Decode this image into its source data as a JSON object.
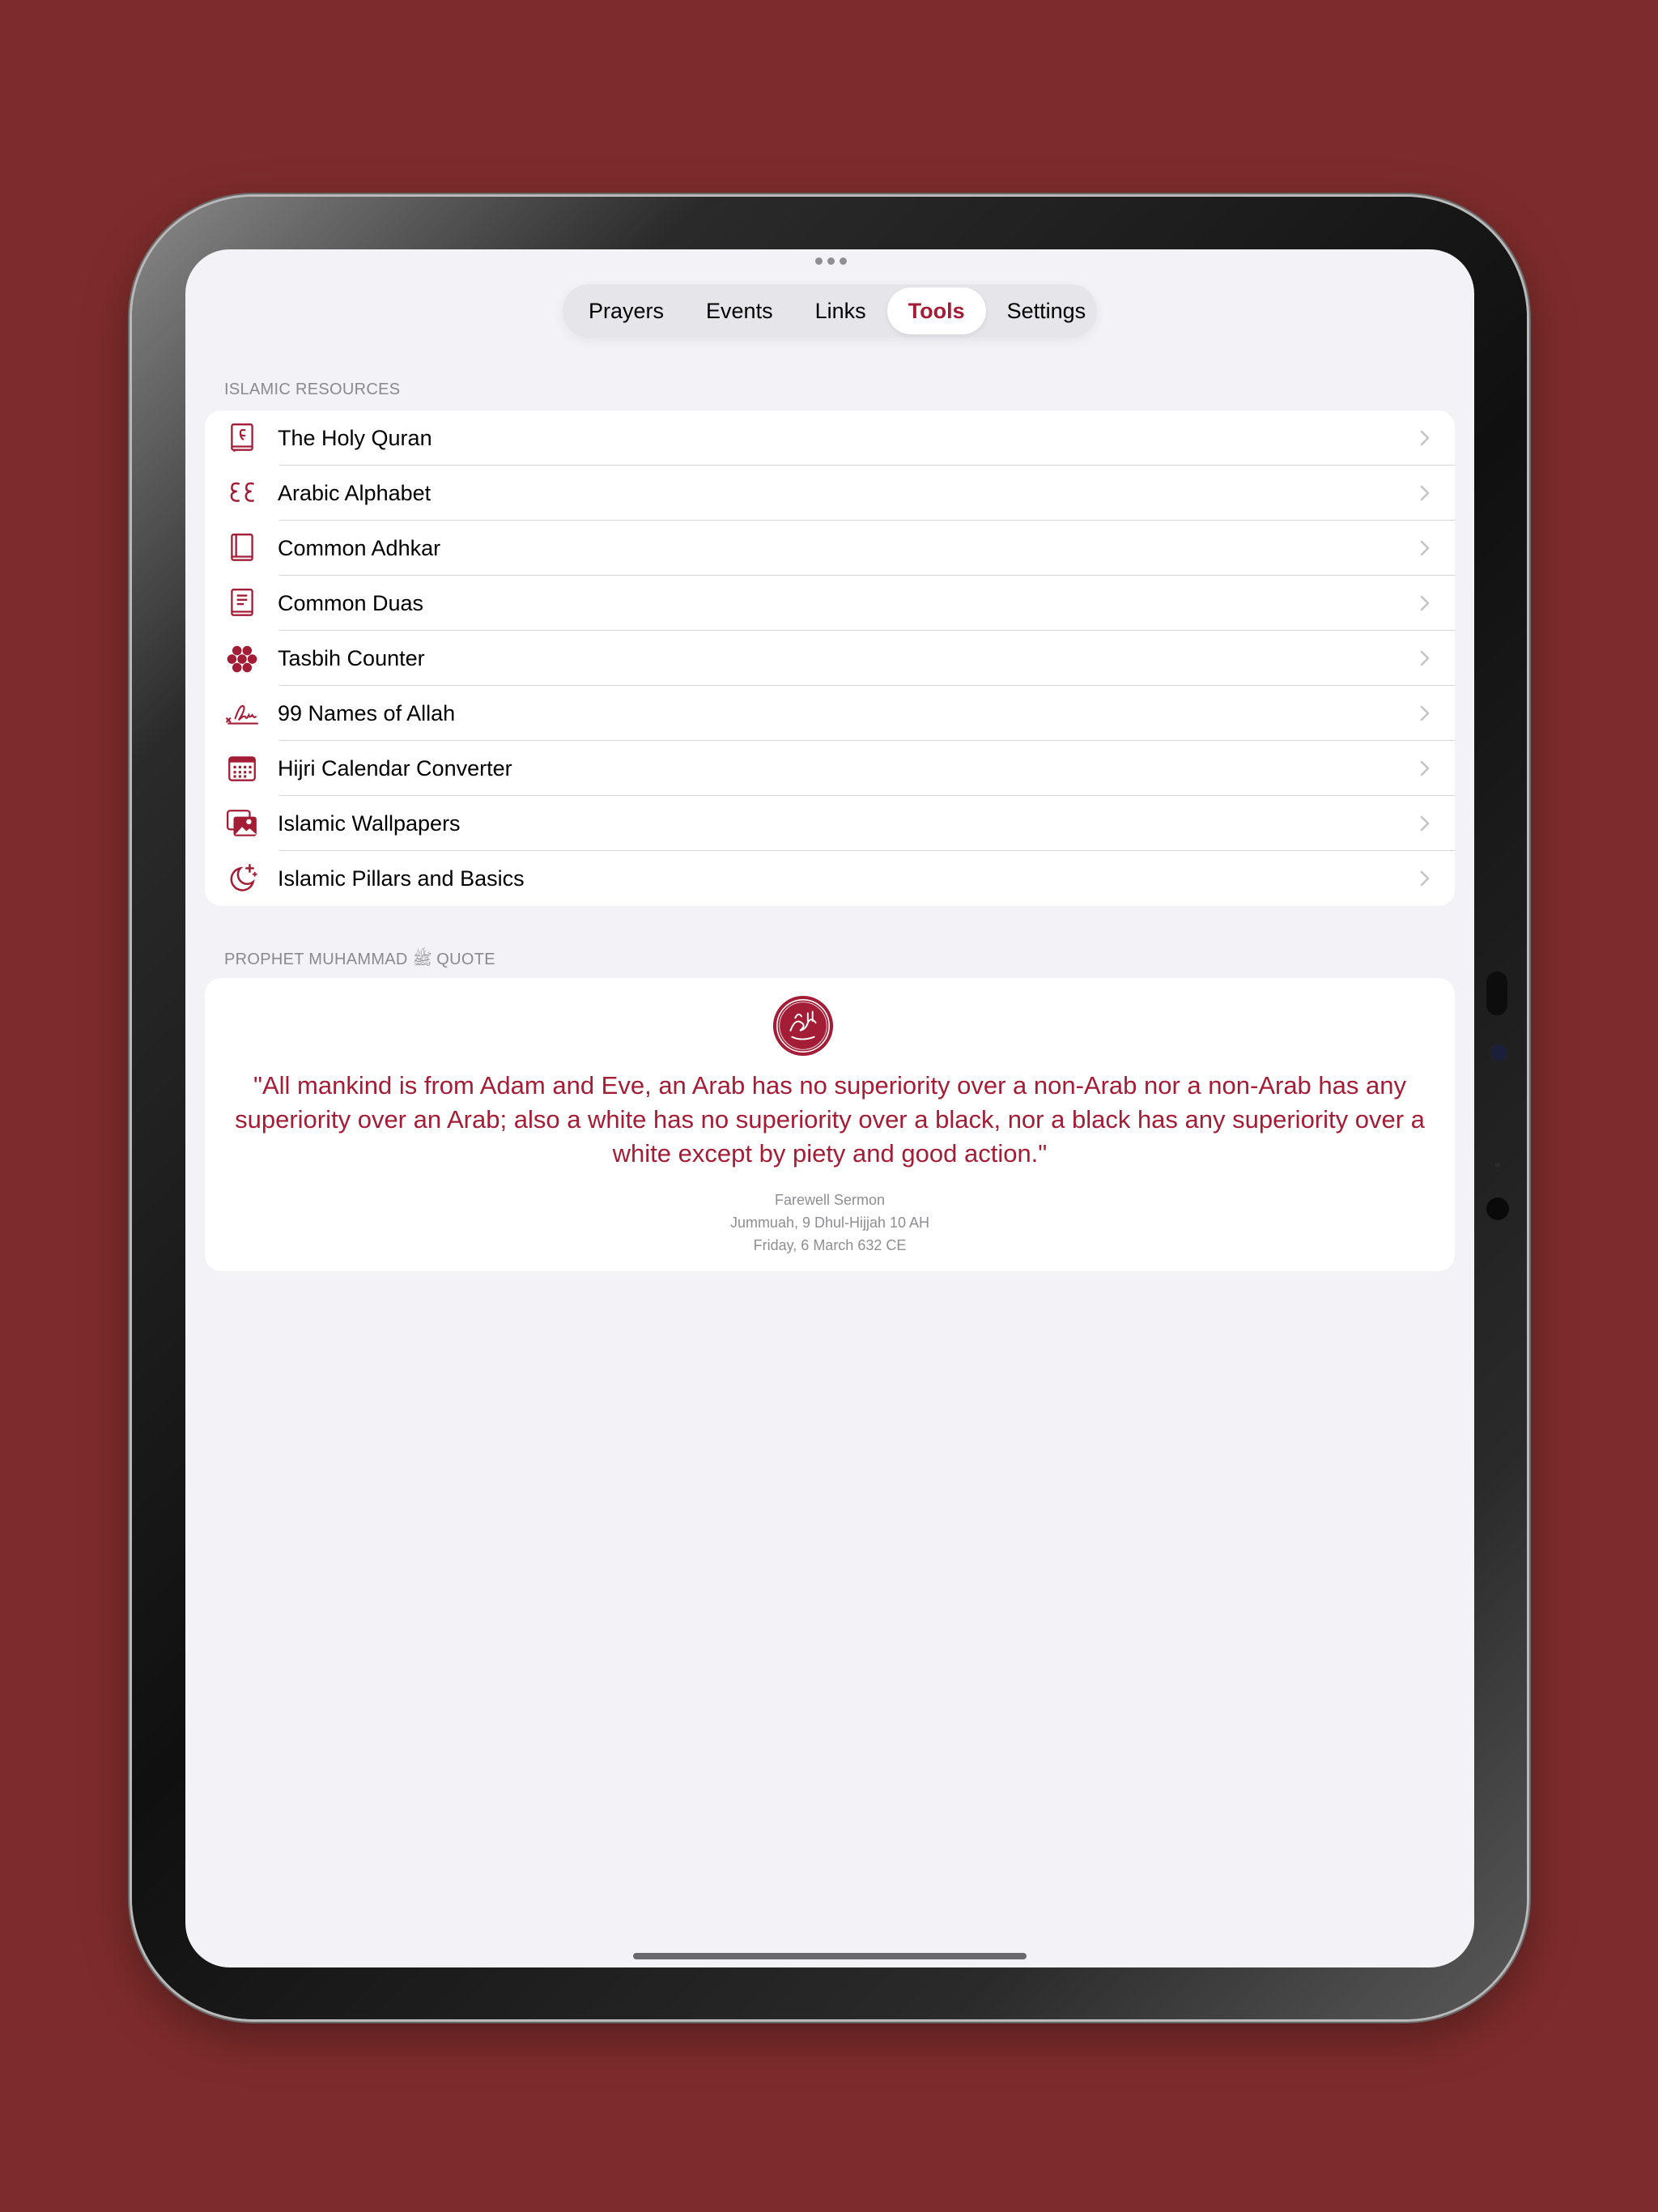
{
  "accent_color": "#a31d37",
  "background_color": "#7d2c2b",
  "tabs": [
    {
      "label": "Prayers",
      "active": false
    },
    {
      "label": "Events",
      "active": false
    },
    {
      "label": "Links",
      "active": false
    },
    {
      "label": "Tools",
      "active": true
    },
    {
      "label": "Settings",
      "active": false
    }
  ],
  "resources": {
    "header": "ISLAMIC RESOURCES",
    "items": [
      {
        "label": "The Holy Quran",
        "icon": "quran-book-icon"
      },
      {
        "label": "Arabic Alphabet",
        "icon": "arabic-letters-icon"
      },
      {
        "label": "Common Adhkar",
        "icon": "book-icon"
      },
      {
        "label": "Common Duas",
        "icon": "text-book-icon"
      },
      {
        "label": "Tasbih Counter",
        "icon": "tasbih-beads-icon"
      },
      {
        "label": "99 Names of Allah",
        "icon": "signature-icon"
      },
      {
        "label": "Hijri Calendar Converter",
        "icon": "calendar-icon"
      },
      {
        "label": "Islamic Wallpapers",
        "icon": "photos-icon"
      },
      {
        "label": "Islamic Pillars and Basics",
        "icon": "moon-stars-icon"
      }
    ]
  },
  "quote": {
    "header": "PROPHET MUHAMMAD ﷺ QUOTE",
    "seal_icon": "prophet-seal-icon",
    "text": "\"All mankind is from Adam and Eve, an Arab has no superiority over a non-Arab nor a non-Arab has any superiority over an Arab; also a white has no superiority over a black, nor a black has any superiority over a white except by piety and good action.\"",
    "source_line1": "Farewell Sermon",
    "source_line2": "Jummuah, 9 Dhul-Hijjah 10 AH",
    "source_line3": "Friday, 6 March 632 CE"
  }
}
